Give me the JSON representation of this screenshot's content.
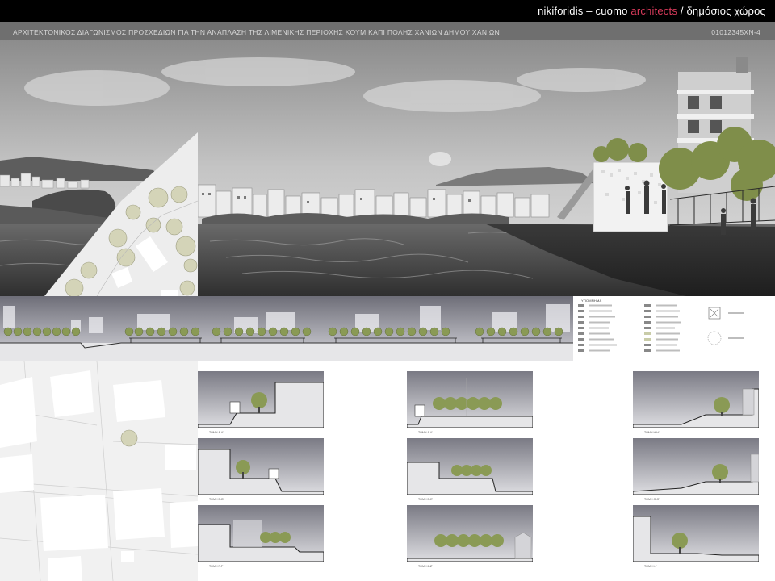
{
  "header": {
    "brand_prefix": "nikiforidis – cuomo ",
    "brand_accent": "architects",
    "brand_suffix": " / δημόσιος χώρος",
    "title": "ΑΡΧΙΤΕΚΤΟΝΙΚΟΣ ΔΙΑΓΩΝΙΣΜΟΣ ΠΡΟΣΧΕΔΙΩΝ ΓΙΑ ΤΗΝ ΑΝΑΠΛΑΣΗ ΤΗΣ ΛΙΜΕΝΙΚΗΣ ΠΕΡΙΟΧΗΣ ΚΟΥΜ ΚΑΠΙ ΠΟΛΗΣ ΧΑΝΙΩΝ ΔΗΜΟΥ ΧΑΝΙΩΝ",
    "code": "01012345ΧΝ-4"
  },
  "colors": {
    "accent": "#d63a5a",
    "bar": "#000000",
    "header": "#6f6f6f",
    "tree": "#8a9a55"
  },
  "legend": {
    "title": "ΥΠΟΜΝΗΜΑ"
  },
  "sections": [
    {
      "label": "ΤΟΜΗ Α-Α'"
    },
    {
      "label": "ΤΟΜΗ Δ-Δ'"
    },
    {
      "label": "ΤΟΜΗ Η-Η'"
    },
    {
      "label": "ΤΟΜΗ Β-Β'"
    },
    {
      "label": "ΤΟΜΗ Ε-Ε'"
    },
    {
      "label": "ΤΟΜΗ Θ-Θ'"
    },
    {
      "label": "ΤΟΜΗ Γ-Γ'"
    },
    {
      "label": "ΤΟΜΗ Ζ-Ζ'"
    },
    {
      "label": "ΤΟΜΗ Ι-Ι'"
    }
  ]
}
